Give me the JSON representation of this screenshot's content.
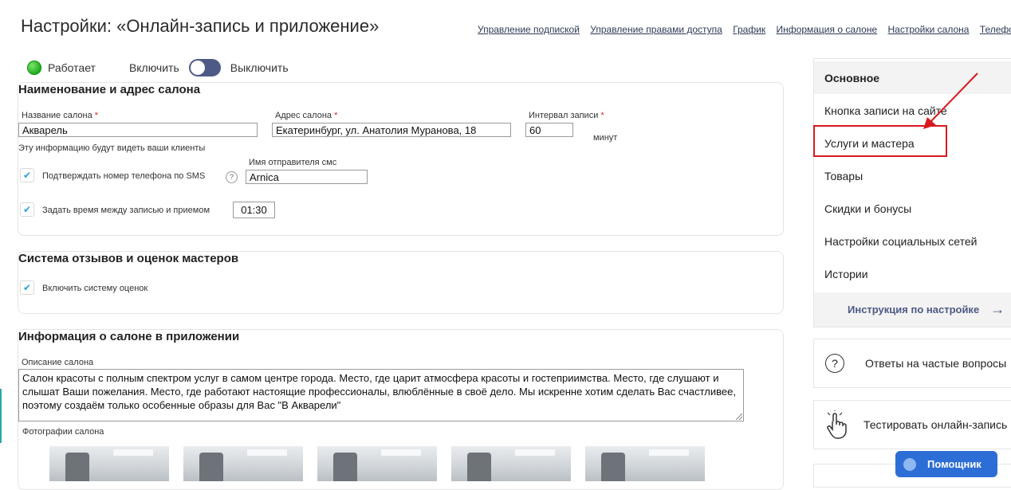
{
  "page": {
    "title": "Настройки: «Онлайн-запись и приложение»",
    "nav": [
      "Управление подпиской",
      "Управление правами доступа",
      "График",
      "Информация о салоне",
      "Настройки салона",
      "Телефония"
    ]
  },
  "status": {
    "state": "Работает",
    "on_label": "Включить",
    "off_label": "Выключить",
    "indicator_color": "#1aa51c",
    "toggle_color": "#4d5a86"
  },
  "salon": {
    "title": "Наименование и адрес салона",
    "name_label": "Название салона",
    "name_value": "Акварель",
    "address_label": "Адрес салона",
    "address_value": "Екатеринбург, ул. Анатолия Муранова, 18",
    "interval_label": "Интервал записи",
    "interval_value": "60",
    "interval_unit": "минут",
    "required_mark": "*",
    "hint": "Эту информацию будут видеть ваши клиенты",
    "sms_confirm_label": "Подтверждать номер телефона по SMS",
    "help_glyph": "?",
    "sms_sender_label": "Имя отправителя смс",
    "sms_sender_value": "Arnica",
    "time_gap_label": "Задать время между записью и приемом",
    "time_gap_value": "01:30"
  },
  "reviews": {
    "title": "Система отзывов и оценок мастеров",
    "enable_label": "Включить систему оценок"
  },
  "app_info": {
    "title": "Информация о салоне в приложении",
    "description_label": "Описание салона",
    "description_line1": "Салон красоты с полным спектром услуг в самом центре города. Место, где царит атмосфера красоты и гостеприимства. Место, где слушают и",
    "description_line2": "слышат Ваши пожелания. Место, где работают настоящие профессионалы, влюблённые в своё дело. Мы искренне хотим сделать Вас счастливее,",
    "description_line3": "поэтому создаём только особенные образы для Вас \"В Акварели\"",
    "photos_label": "Фотографии салона"
  },
  "menu": {
    "items": [
      "Основное",
      "Кнопка записи на сайте",
      "Услуги и мастера",
      "Товары",
      "Скидки и бонусы",
      "Настройки социальных сетей",
      "Истории"
    ],
    "footer": "Инструкция по настройке",
    "footer_arrow": "→",
    "highlight_color": "#d8191f"
  },
  "faq": {
    "label": "Ответы на частые вопросы",
    "icon_glyph": "?"
  },
  "test": {
    "label": "Тестировать онлайн-запись"
  },
  "helper": {
    "label": "Помощник",
    "color": "#2d6ed6"
  },
  "checkmark": "✔"
}
